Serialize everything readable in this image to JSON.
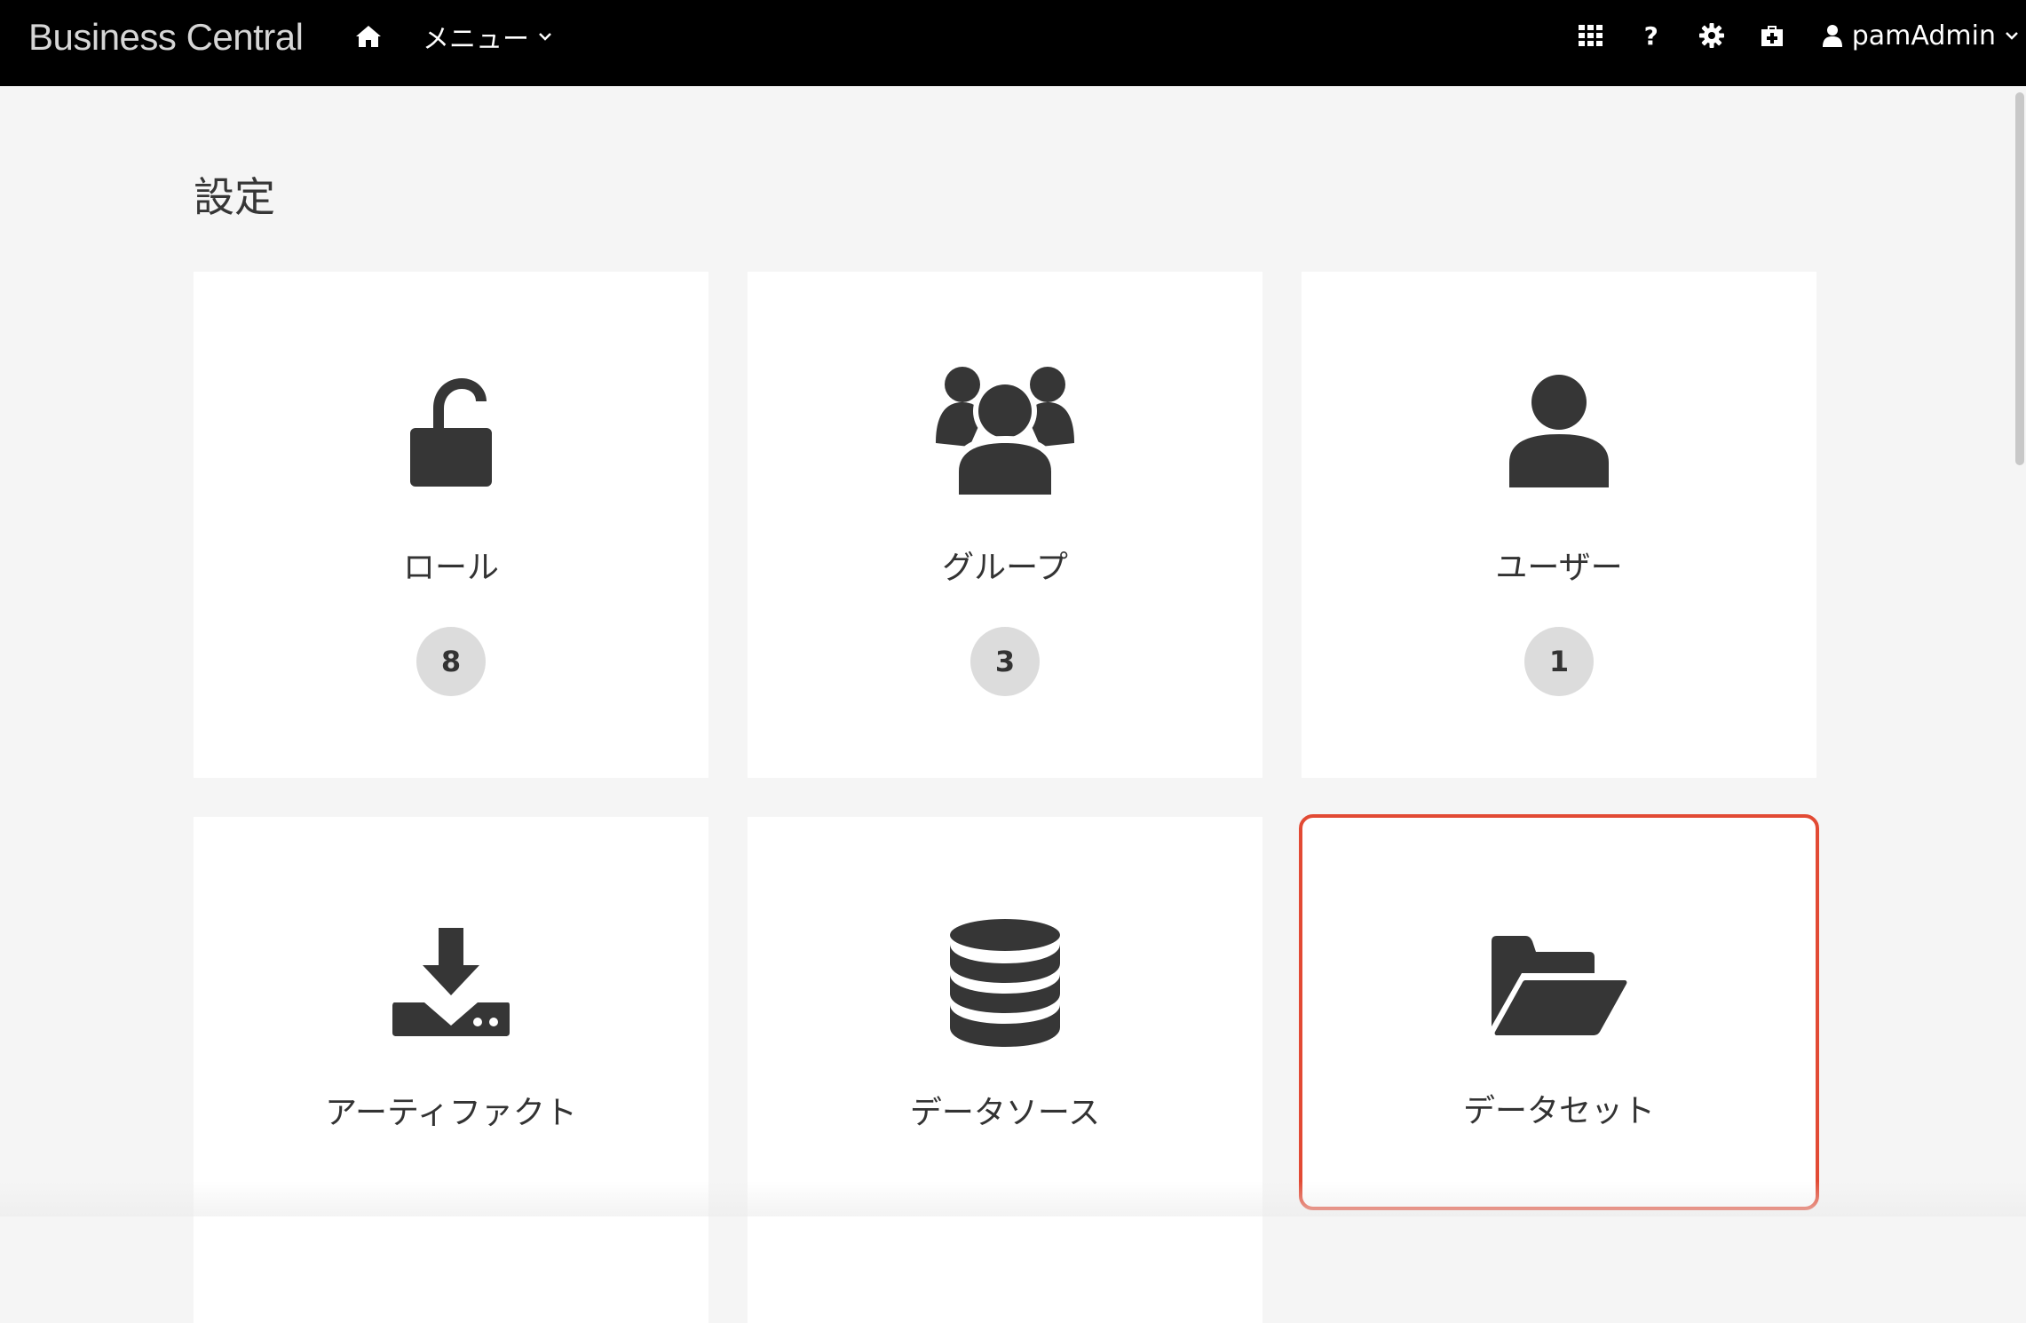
{
  "header": {
    "brand": "Business Central",
    "menu_label": "メニュー",
    "user_name": "pamAdmin"
  },
  "page": {
    "title": "設定"
  },
  "cards": [
    {
      "label": "ロール",
      "count": "8",
      "icon": "unlock-icon"
    },
    {
      "label": "グループ",
      "count": "3",
      "icon": "users-icon"
    },
    {
      "label": "ユーザー",
      "count": "1",
      "icon": "user-icon"
    },
    {
      "label": "アーティファクト",
      "icon": "download-icon"
    },
    {
      "label": "データソース",
      "icon": "database-icon"
    },
    {
      "label": "データセット",
      "icon": "folder-open-icon"
    }
  ],
  "colors": {
    "topbar": "#000000",
    "highlight_border": "#e24a34",
    "badge": "#dcdcdc",
    "icon": "#363636"
  }
}
